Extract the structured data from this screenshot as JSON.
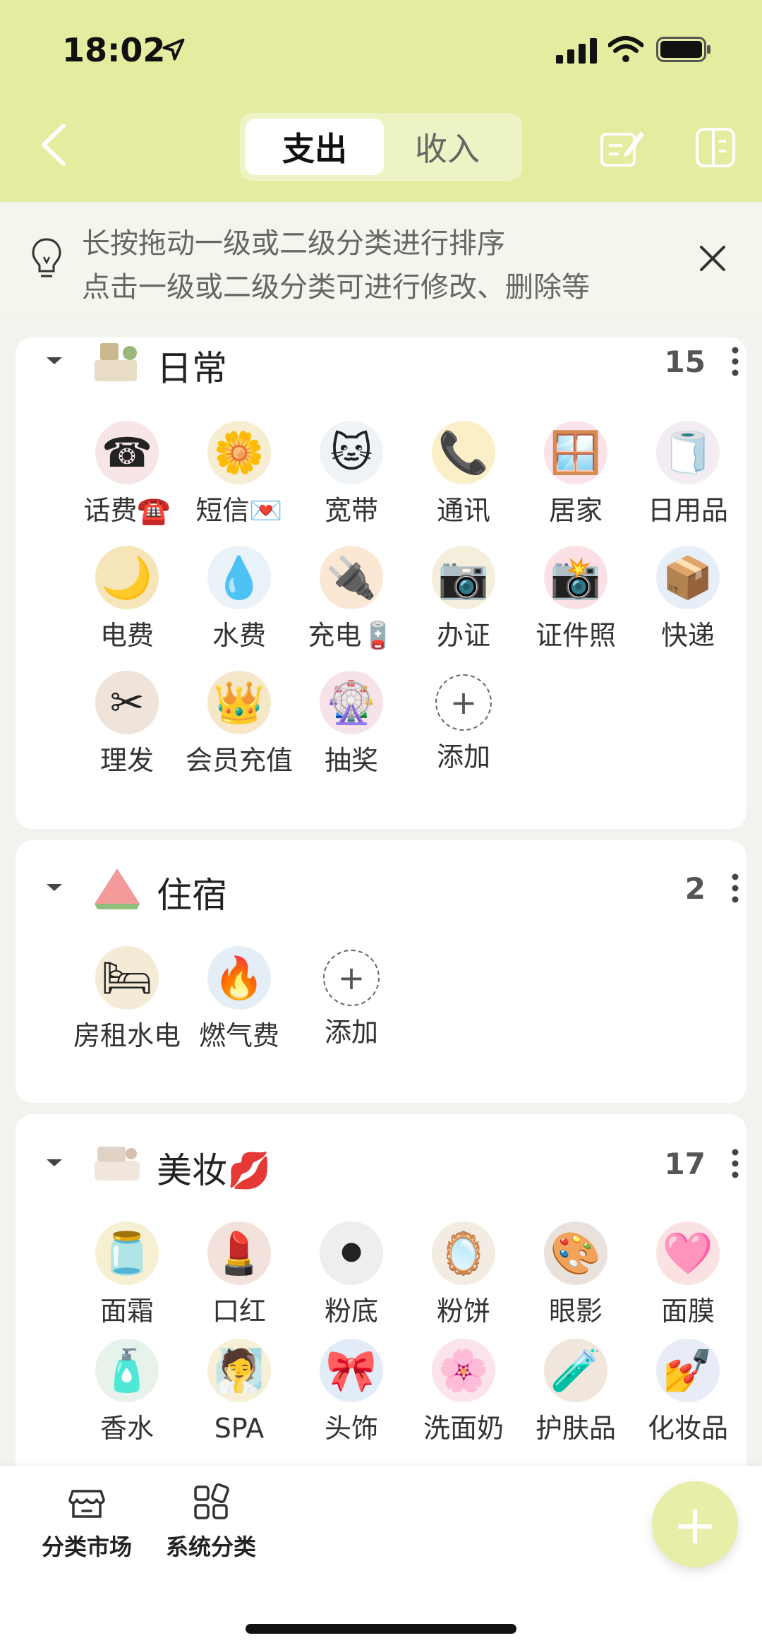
{
  "status": {
    "time": "18:02"
  },
  "header": {
    "tabs": [
      {
        "label": "支出",
        "active": true
      },
      {
        "label": "收入",
        "active": false
      }
    ],
    "bg_color": "#e4ec9f"
  },
  "tip": {
    "line1": "长按拖动一级或二级分类进行排序",
    "line2": "点击一级或二级分类可进行修改、删除等"
  },
  "categories": [
    {
      "title": "日常",
      "count": "15",
      "items": [
        "话费☎️",
        "短信💌",
        "宽带",
        "通讯",
        "居家",
        "日用品",
        "电费",
        "水费",
        "充电🪫",
        "办证",
        "证件照",
        "快递",
        "理发",
        "会员充值",
        "抽奖"
      ],
      "add_label": "添加"
    },
    {
      "title": "住宿",
      "count": "2",
      "items": [
        "房租水电",
        "燃气费"
      ],
      "add_label": "添加"
    },
    {
      "title": "美妆💋",
      "count": "17",
      "items": [
        "面霜",
        "口红",
        "粉底",
        "粉饼",
        "眼影",
        "面膜",
        "香水",
        "SPA",
        "头饰",
        "洗面奶",
        "护肤品",
        "化妆品"
      ]
    }
  ],
  "bottom_nav": {
    "market": "分类市场",
    "system": "系统分类"
  },
  "fab_label": "+"
}
